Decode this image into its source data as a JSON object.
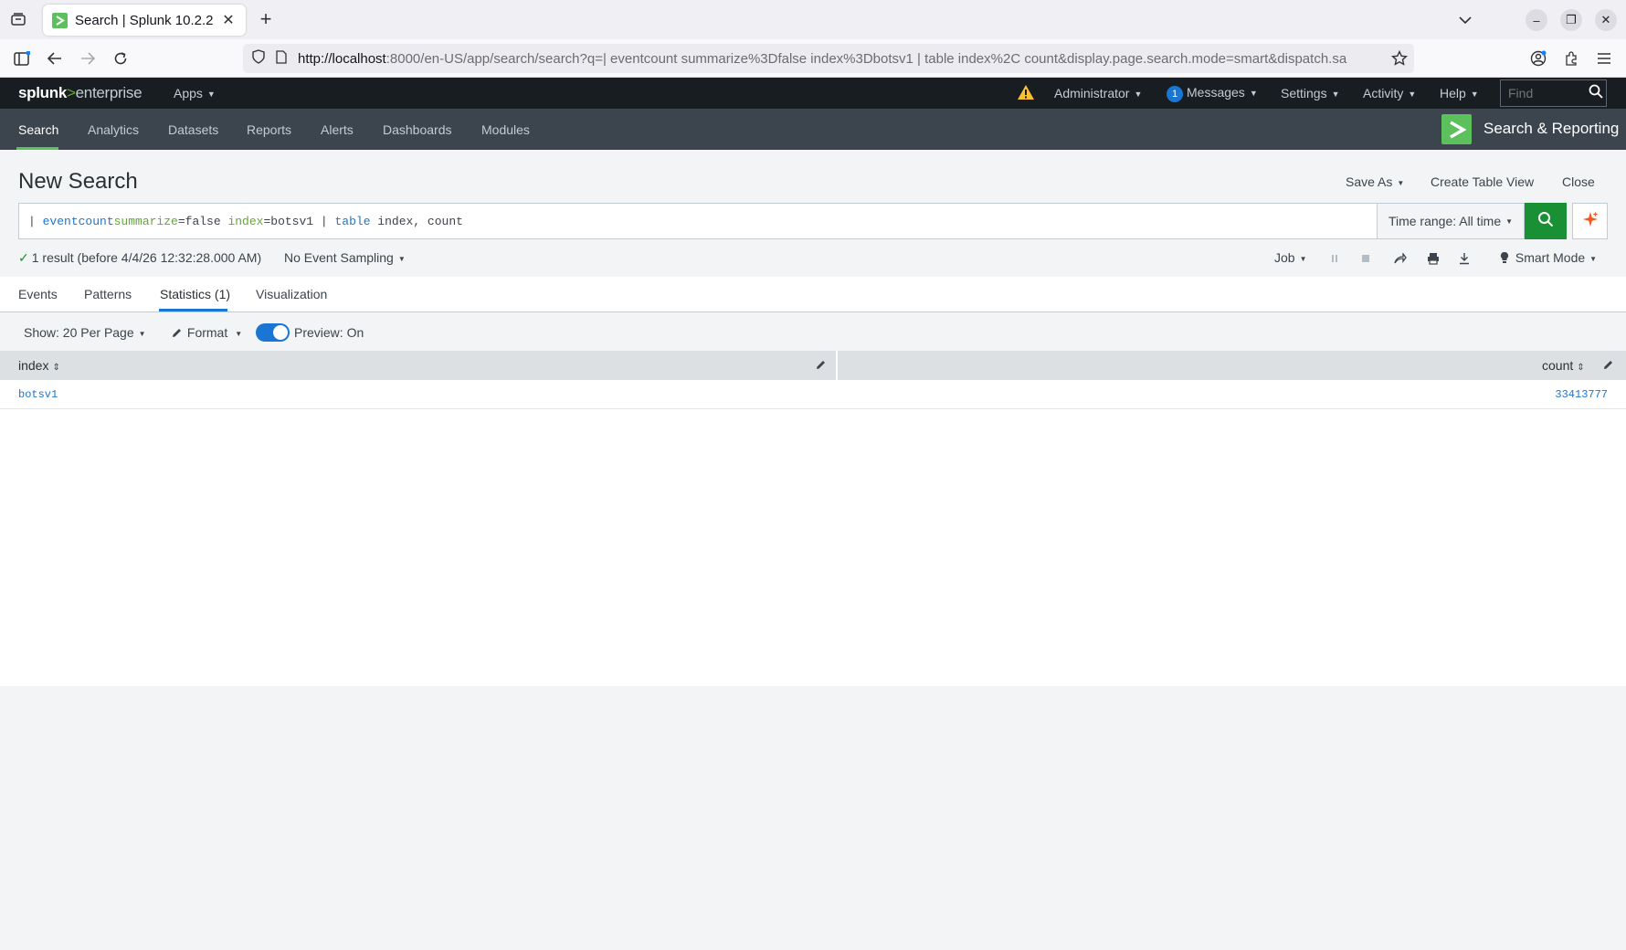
{
  "browser": {
    "tab_title": "Search | Splunk 10.2.2",
    "url_host": "http://localhost",
    "url_rest": ":8000/en-US/app/search/search?q=| eventcount summarize%3Dfalse index%3Dbotsv1 | table index%2C count&display.page.search.mode=smart&dispatch.sa"
  },
  "topbar": {
    "logo_splunk": "splunk",
    "logo_gt": ">",
    "logo_enterprise": "enterprise",
    "apps": "Apps",
    "user": "Administrator",
    "messages_count": "1",
    "messages": "Messages",
    "settings": "Settings",
    "activity": "Activity",
    "help": "Help",
    "find_placeholder": "Find"
  },
  "appbar": {
    "items": [
      "Search",
      "Analytics",
      "Datasets",
      "Reports",
      "Alerts",
      "Dashboards",
      "Modules"
    ],
    "app_name": "Search & Reporting"
  },
  "search": {
    "title": "New Search",
    "save_as": "Save As",
    "create_table_view": "Create Table View",
    "close": "Close",
    "query_tokens": {
      "pipe1": "| ",
      "cmd1": "eventcount",
      "arg1": "summarize",
      "val1": "=false ",
      "arg2": "index",
      "val2": "=botsv1 | ",
      "cmd2": "table",
      "rest": " index, count"
    },
    "time_range": "Time range: All time"
  },
  "status": {
    "result_text": "1 result (before 4/4/26 12:32:28.000 AM)",
    "sampling": "No Event Sampling",
    "job": "Job",
    "mode": "Smart Mode"
  },
  "result_tabs": [
    "Events",
    "Patterns",
    "Statistics (1)",
    "Visualization"
  ],
  "table_controls": {
    "show": "Show: 20 Per Page",
    "format": "Format",
    "preview": "Preview: On"
  },
  "table": {
    "columns": [
      "index",
      "count"
    ],
    "rows": [
      [
        "botsv1",
        "33413777"
      ]
    ]
  }
}
